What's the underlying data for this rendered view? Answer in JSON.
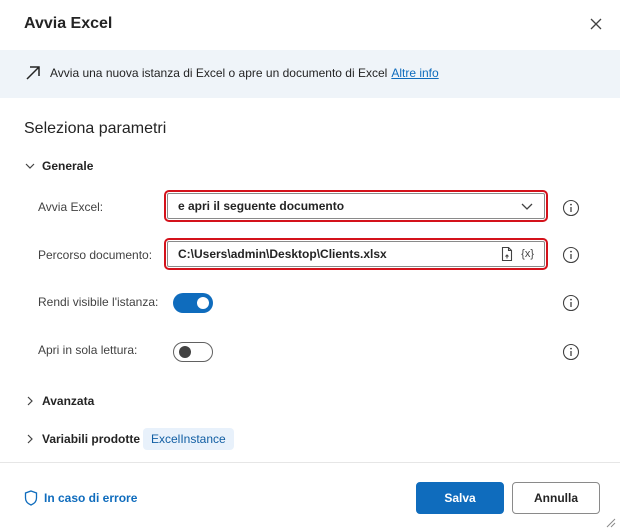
{
  "dialog": {
    "title": "Avvia Excel"
  },
  "banner": {
    "text": "Avvia una nuova istanza di Excel o apre un documento di Excel",
    "link": "Altre info"
  },
  "section_title": "Seleziona parametri",
  "groups": {
    "general": "Generale",
    "advanced": "Avanzata",
    "produced_vars": "Variabili prodotte"
  },
  "params": {
    "launch_excel": {
      "label": "Avvia Excel:",
      "value": "e apri il seguente documento"
    },
    "doc_path": {
      "label": "Percorso documento:",
      "value": "C:\\Users\\admin\\Desktop\\Clients.xlsx",
      "var_button": "{x}"
    },
    "visible_instance": {
      "label": "Rendi visibile l'istanza:",
      "on": true
    },
    "read_only": {
      "label": "Apri in sola lettura:",
      "on": false
    }
  },
  "produced_variable": "ExcelInstance",
  "footer": {
    "on_error": "In caso di errore",
    "save": "Salva",
    "cancel": "Annulla"
  },
  "colors": {
    "accent": "#0f6cbd",
    "highlight_border": "#d4121b",
    "banner_bg": "#eff4f9"
  }
}
